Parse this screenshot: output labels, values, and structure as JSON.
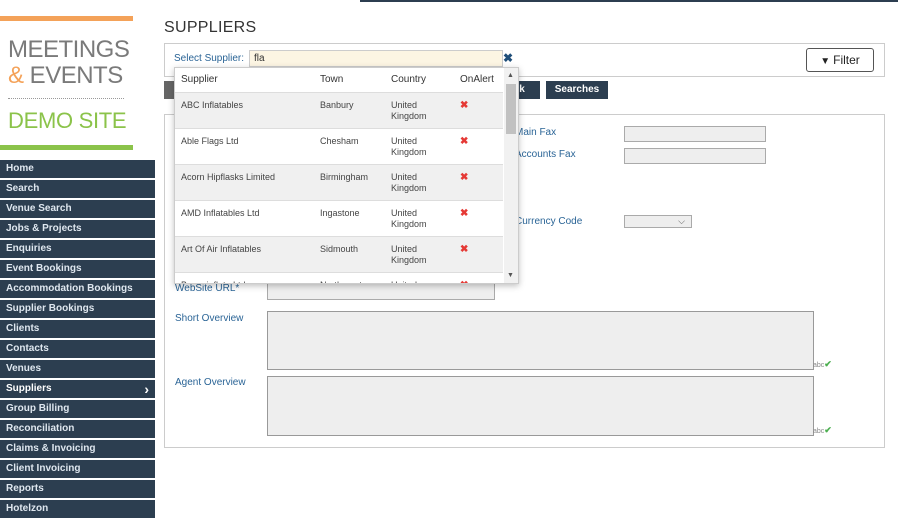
{
  "logo": {
    "line1": "MEETINGS",
    "amp": "&",
    "line2": " EVENTS",
    "line3": "DEMO SITE"
  },
  "nav": [
    {
      "label": "Home"
    },
    {
      "label": "Search"
    },
    {
      "label": "Venue Search"
    },
    {
      "label": "Jobs & Projects"
    },
    {
      "label": "Enquiries"
    },
    {
      "label": "Event Bookings"
    },
    {
      "label": "Accommodation Bookings"
    },
    {
      "label": "Supplier Bookings"
    },
    {
      "label": "Clients"
    },
    {
      "label": "Contacts"
    },
    {
      "label": "Venues"
    },
    {
      "label": "Suppliers",
      "active": true
    },
    {
      "label": "Group Billing"
    },
    {
      "label": "Reconciliation"
    },
    {
      "label": "Claims & Invoicing"
    },
    {
      "label": "Client Invoicing"
    },
    {
      "label": "Reports"
    },
    {
      "label": "Hotelzon"
    }
  ],
  "page": {
    "title": "SUPPLIERS"
  },
  "search": {
    "label": "Select Supplier:",
    "value": "fla",
    "clear": "✖"
  },
  "filter": {
    "label": "Filter",
    "icon": "funnel-icon"
  },
  "tabs": {
    "t1": "k",
    "t2": "Searches"
  },
  "dropdown": {
    "headers": {
      "supplier": "Supplier",
      "town": "Town",
      "country": "Country",
      "onalert": "OnAlert"
    },
    "rows": [
      {
        "supplier": "ABC Inflatables",
        "town": "Banbury",
        "country": "United Kingdom",
        "alert": "✖"
      },
      {
        "supplier": "Able Flags Ltd",
        "town": "Chesham",
        "country": "United Kingdom",
        "alert": "✖"
      },
      {
        "supplier": "Acorn Hipflasks Limited",
        "town": "Birmingham",
        "country": "United Kingdom",
        "alert": "✖"
      },
      {
        "supplier": "AMD Inflatables Ltd",
        "town": "Ingastone",
        "country": "United Kingdom",
        "alert": "✖"
      },
      {
        "supplier": "Art Of Air Inflatables",
        "town": "Sidmouth",
        "country": "United Kingdom",
        "alert": "✖"
      },
      {
        "supplier": "Baconinflate Ltd",
        "town": "Northampton",
        "country": "United",
        "alert": "✖"
      }
    ]
  },
  "form": {
    "main_fax": "Main Fax",
    "accounts_fax": "Accounts Fax",
    "currency_code": "Currency Code",
    "website_url": "WebSite URL*",
    "short_overview": "Short Overview",
    "agent_overview": "Agent Overview",
    "spell": "abc"
  },
  "colors": {
    "nav_bg": "#2c3e50",
    "accent_orange": "#f4a259",
    "accent_green": "#8bc34a",
    "link_blue": "#2a6496",
    "alert_red": "#e53935"
  }
}
